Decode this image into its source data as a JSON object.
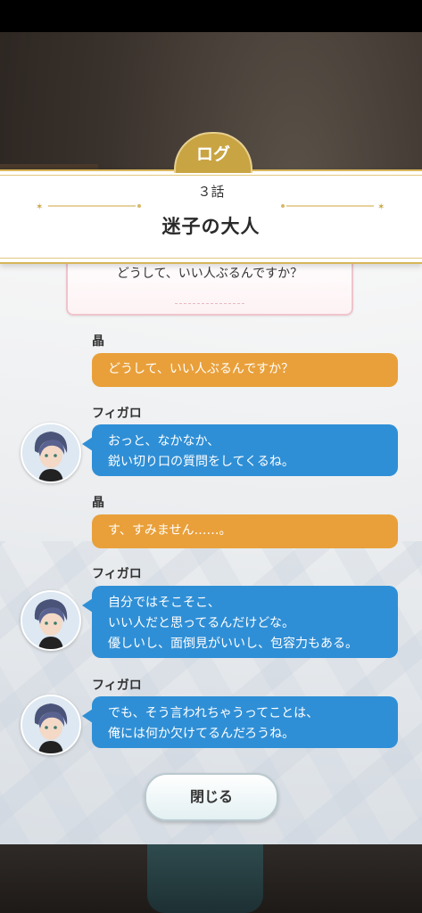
{
  "header": {
    "tab_label": "ログ",
    "episode": "３話",
    "title": "迷子の大人"
  },
  "choice": {
    "text": "どうして、いい人ぶるんですか？"
  },
  "log": [
    {
      "speaker": "晶",
      "kind": "player",
      "lines": [
        "どうして、いい人ぶるんですか？"
      ]
    },
    {
      "speaker": "フィガロ",
      "kind": "npc",
      "lines": [
        "おっと、なかなか、",
        "鋭い切り口の質問をしてくるね。"
      ]
    },
    {
      "speaker": "晶",
      "kind": "player",
      "lines": [
        "す、すみません……。"
      ]
    },
    {
      "speaker": "フィガロ",
      "kind": "npc",
      "lines": [
        "自分ではそこそこ、",
        "いい人だと思ってるんだけどな。",
        "優しいし、面倒見がいいし、包容力もある。"
      ]
    },
    {
      "speaker": "フィガロ",
      "kind": "npc",
      "lines": [
        "でも、そう言われちゃうってことは、",
        "俺には何か欠けてるんだろうね。"
      ]
    }
  ],
  "close_label": "閉じる",
  "colors": {
    "accent_gold": "#c9a443",
    "player_bubble": "#e9a03a",
    "npc_bubble": "#2f8fd6"
  },
  "icons": {
    "avatar": "figaro-avatar"
  }
}
